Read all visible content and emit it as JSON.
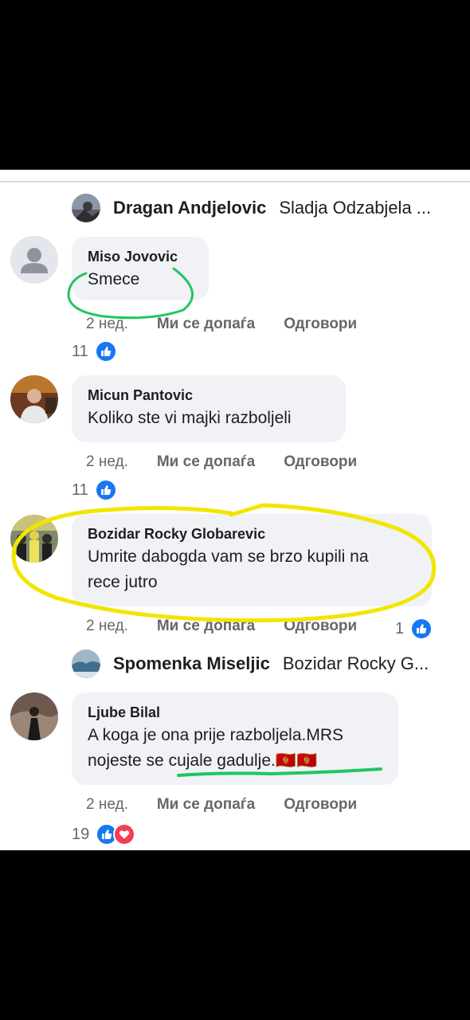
{
  "colors": {
    "like": "#1877f2",
    "heart": "#f33e58",
    "bubble": "#f0f2f5",
    "highlight_green": "#22c55e",
    "highlight_yellow": "#f2e600"
  },
  "reply1": {
    "name": "Dragan Andjelovic",
    "replying_to": "Sladja Odzabjela ..."
  },
  "comments": [
    {
      "name": "Miso Jovovic",
      "lines": [
        "Smece"
      ],
      "time": "2 нед.",
      "like": "Ми се допаѓа",
      "reply": "Одговори",
      "reactions": "11",
      "reaction_icons": [
        "like-icon"
      ]
    },
    {
      "name": "Micun Pantovic",
      "lines": [
        "Koliko ste vi majki razboljeli"
      ],
      "time": "2 нед.",
      "like": "Ми се допаѓа",
      "reply": "Одговори",
      "reactions": "11",
      "reaction_icons": [
        "like-icon"
      ]
    },
    {
      "name": "Bozidar Rocky Globarevic",
      "lines": [
        "Umrite dabogda vam se brzo kupili na",
        "rece jutro"
      ],
      "time": "2 нед.",
      "like": "Ми се допаѓа",
      "reply": "Одговори",
      "reactions": "1",
      "reaction_icons": [
        "like-icon"
      ]
    },
    {
      "name": "Ljube Bilal",
      "lines": [
        "A koga je ona prije razboljela.MRS",
        "nojeste se cujale gadulje.🇲🇪🇲🇪"
      ],
      "time": "2 нед.",
      "like": "Ми се допаѓа",
      "reply": "Одговори",
      "reactions": "19",
      "reaction_icons": [
        "like-icon",
        "heart-icon"
      ]
    }
  ],
  "reply2": {
    "name": "Spomenka Miseljic",
    "replying_to": "Bozidar Rocky G..."
  }
}
